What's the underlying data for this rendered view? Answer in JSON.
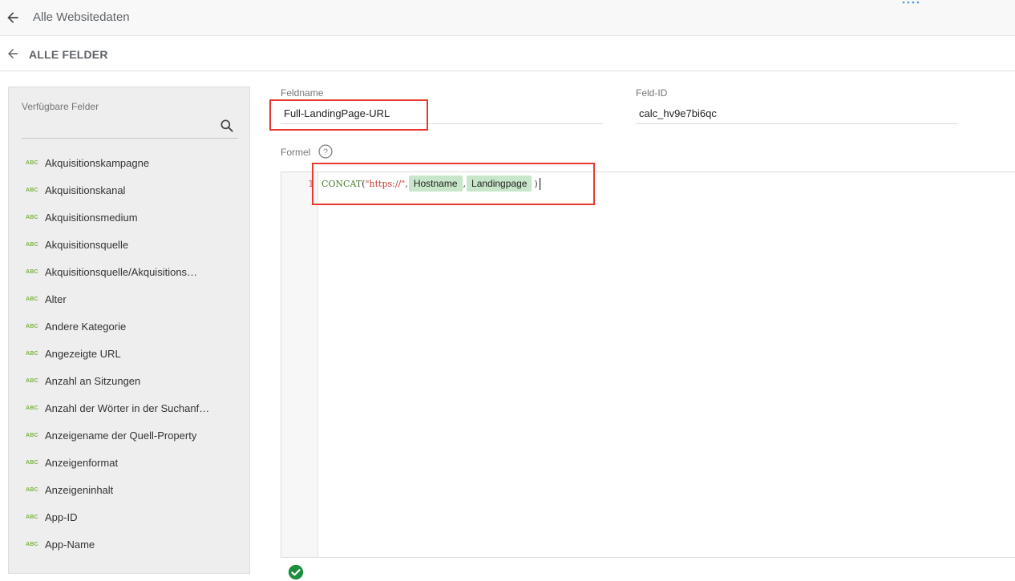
{
  "header": {
    "title": "Alle Websitedaten",
    "back_icon": "arrow-left-icon",
    "more_icon": "more-dots-icon"
  },
  "subheader": {
    "title": "ALLE FELDER",
    "back_icon": "arrow-left-icon"
  },
  "sidebar": {
    "label": "Verfügbare Felder",
    "search_icon": "search-icon",
    "type_badge": "ABC",
    "items": [
      "Akquisitionskampagne",
      "Akquisitionskanal",
      "Akquisitionsmedium",
      "Akquisitionsquelle",
      "Akquisitionsquelle/Akquisitions…",
      "Alter",
      "Andere Kategorie",
      "Angezeigte URL",
      "Anzahl an Sitzungen",
      "Anzahl der Wörter in der Suchanf…",
      "Anzeigename der Quell-Property",
      "Anzeigenformat",
      "Anzeigeninhalt",
      "App-ID",
      "App-Name"
    ]
  },
  "form": {
    "field_name_label": "Feldname",
    "field_name_value": "Full-LandingPage-URL",
    "field_id_label": "Feld-ID",
    "field_id_value": "calc_hv9e7bi6qc",
    "formula_label": "Formel"
  },
  "editor": {
    "line_number": "1",
    "fn": "CONCAT",
    "open_paren": "(",
    "string_literal": "\"https://\"",
    "comma": ",",
    "chip1": "Hostname",
    "chip2": "Landingpage",
    "close_paren": ")"
  },
  "colors": {
    "highlight_border": "#e8392e",
    "chip_bg": "#c8e6c9",
    "valid_green": "#1e8e3e"
  }
}
